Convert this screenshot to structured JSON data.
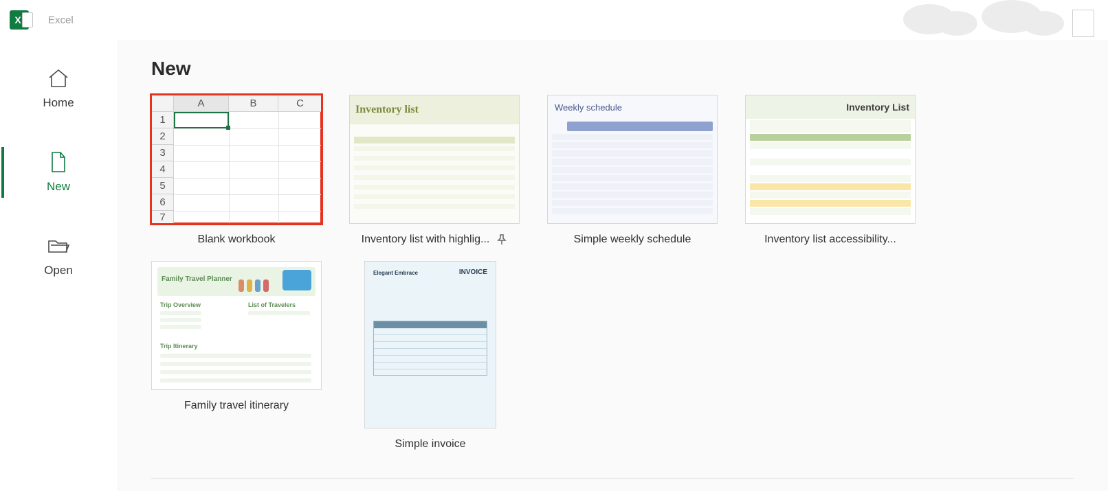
{
  "app": {
    "name": "Excel",
    "icon_letter": "X"
  },
  "nav": {
    "home": "Home",
    "new": "New",
    "open": "Open"
  },
  "page": {
    "title": "New"
  },
  "templates": [
    {
      "id": "blank",
      "label": "Blank workbook",
      "selected": true,
      "pinned": false
    },
    {
      "id": "invlist",
      "label": "Inventory list with highlig...",
      "selected": false,
      "pinned": true
    },
    {
      "id": "weekly",
      "label": "Simple weekly schedule",
      "selected": false,
      "pinned": false
    },
    {
      "id": "inv2",
      "label": "Inventory list accessibility...",
      "selected": false,
      "pinned": false
    },
    {
      "id": "family",
      "label": "Family travel itinerary",
      "selected": false,
      "pinned": false
    },
    {
      "id": "invoice",
      "label": "Simple invoice",
      "selected": false,
      "pinned": false
    }
  ],
  "thumb_text": {
    "inventory_list_title": "Inventory list",
    "weekly_title": "Weekly schedule",
    "inv2_title": "Inventory List",
    "family_title": "Family Travel Planner",
    "family_sec1": "Trip Overview",
    "family_sec2": "List of Travelers",
    "family_sec3": "Trip Itinerary",
    "invoice_brand": "Elegant Embrace",
    "invoice_title": "INVOICE"
  },
  "blank_thumb": {
    "cols": [
      "A",
      "B",
      "C"
    ],
    "rows": [
      "1",
      "2",
      "3",
      "4",
      "5",
      "6",
      "7"
    ]
  }
}
